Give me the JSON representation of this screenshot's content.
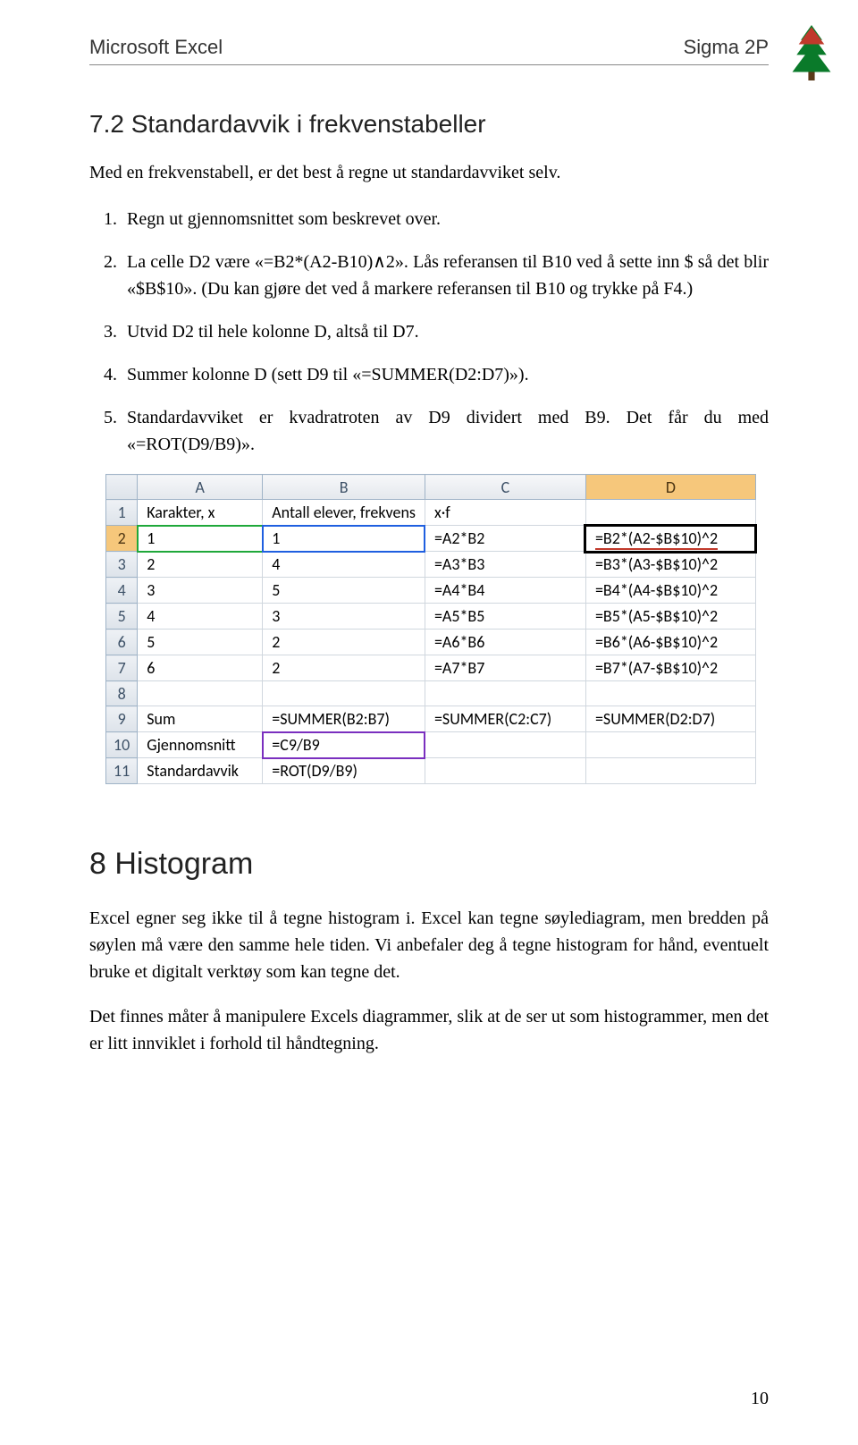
{
  "header": {
    "left": "Microsoft Excel",
    "right": "Sigma 2P"
  },
  "section72": {
    "title": "7.2   Standardavvik i frekvenstabeller",
    "intro": "Med en frekvenstabell, er det best å regne ut standardavviket selv.",
    "steps": [
      "Regn ut gjennomsnittet som beskrevet over.",
      "La celle D2 være «=B2*(A2-B10)∧2». Lås referansen til B10 ved å sette inn $ så det blir «$B$10». (Du kan gjøre det ved å markere referansen til B10 og trykke på F4.)",
      "Utvid D2 til hele kolonne D, altså til D7.",
      "Summer kolonne D (sett D9 til «=SUMMER(D2:D7)»).",
      "Standardavviket er kvadratroten av D9 dividert med B9. Det får du med «=ROT(D9/B9)»."
    ]
  },
  "excel": {
    "cols": [
      "A",
      "B",
      "C",
      "D"
    ],
    "rows": [
      {
        "n": "1",
        "a": "Karakter, x",
        "b": "Antall elever, frekvens",
        "c": "x·f",
        "d": ""
      },
      {
        "n": "2",
        "a": "1",
        "b": "1",
        "c": "=A2*B2",
        "d": "=B2*(A2-$B$10)^2"
      },
      {
        "n": "3",
        "a": "2",
        "b": "4",
        "c": "=A3*B3",
        "d": "=B3*(A3-$B$10)^2"
      },
      {
        "n": "4",
        "a": "3",
        "b": "5",
        "c": "=A4*B4",
        "d": "=B4*(A4-$B$10)^2"
      },
      {
        "n": "5",
        "a": "4",
        "b": "3",
        "c": "=A5*B5",
        "d": "=B5*(A5-$B$10)^2"
      },
      {
        "n": "6",
        "a": "5",
        "b": "2",
        "c": "=A6*B6",
        "d": "=B6*(A6-$B$10)^2"
      },
      {
        "n": "7",
        "a": "6",
        "b": "2",
        "c": "=A7*B7",
        "d": "=B7*(A7-$B$10)^2"
      },
      {
        "n": "8",
        "a": "",
        "b": "",
        "c": "",
        "d": ""
      },
      {
        "n": "9",
        "a": "Sum",
        "b": "=SUMMER(B2:B7)",
        "c": "=SUMMER(C2:C7)",
        "d": "=SUMMER(D2:D7)"
      },
      {
        "n": "10",
        "a": "Gjennomsnitt",
        "b": "=C9/B9",
        "c": "",
        "d": ""
      },
      {
        "n": "11",
        "a": "Standardavvik",
        "b": "=ROT(D9/B9)",
        "c": "",
        "d": ""
      }
    ]
  },
  "section8": {
    "title": "8   Histogram",
    "p1": "Excel egner seg ikke til å tegne histogram i. Excel kan tegne søylediagram, men bredden på søylen må være den samme hele tiden. Vi anbefaler deg å tegne histogram for hånd, eventuelt bruke et digitalt verktøy som kan tegne det.",
    "p2": "Det finnes måter å manipulere Excels diagrammer, slik at de ser ut som histogrammer, men det er litt innviklet i forhold til håndtegning."
  },
  "page_number": "10"
}
